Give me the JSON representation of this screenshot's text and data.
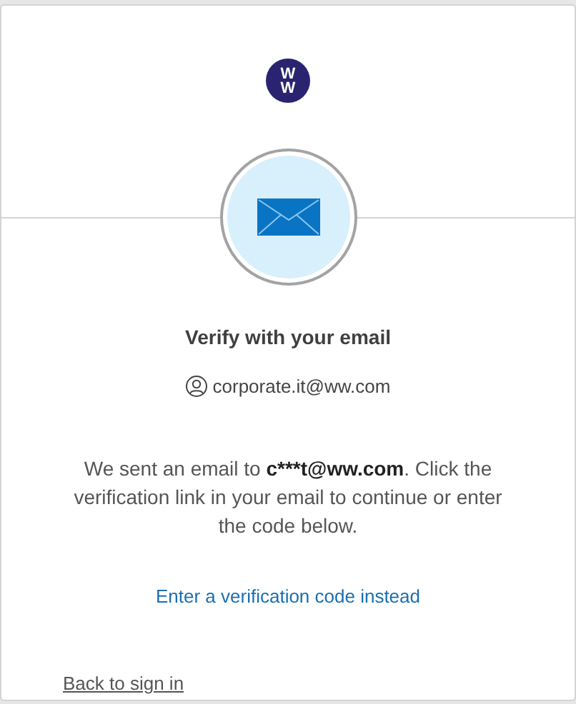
{
  "logo": {
    "lines": [
      "W",
      "W"
    ]
  },
  "title": "Verify with your email",
  "identifier": "corporate.it@ww.com",
  "message": {
    "before": "We sent an email to ",
    "email": "c***t@ww.com",
    "after": ". Click the verification link in your email to continue or enter the code below."
  },
  "code_link": "Enter a verification code instead",
  "back_link": "Back to sign in"
}
